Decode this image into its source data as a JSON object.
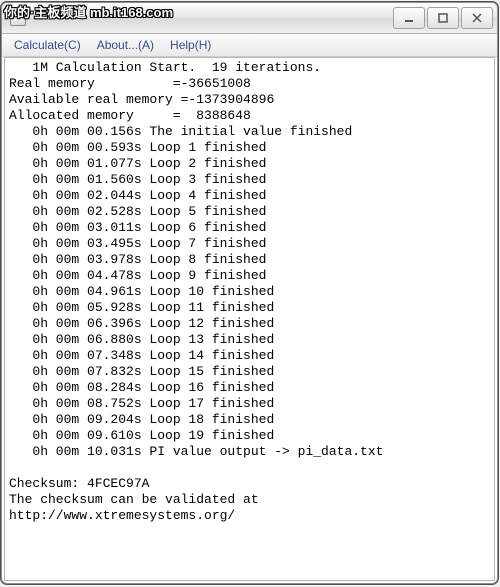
{
  "watermark": "你的·主板频道 mb.it168.com",
  "menubar": {
    "calculate": "Calculate(C)",
    "about": "About...(A)",
    "help": "Help(H)"
  },
  "console": {
    "header": "   1M Calculation Start.  19 iterations.",
    "mem": {
      "real": "Real memory          =-36651008",
      "avail": "Available real memory =-1373904896",
      "alloc": "Allocated memory     =  8388648"
    },
    "initial": "   0h 00m 00.156s The initial value finished",
    "loops": [
      "   0h 00m 00.593s Loop 1 finished",
      "   0h 00m 01.077s Loop 2 finished",
      "   0h 00m 01.560s Loop 3 finished",
      "   0h 00m 02.044s Loop 4 finished",
      "   0h 00m 02.528s Loop 5 finished",
      "   0h 00m 03.011s Loop 6 finished",
      "   0h 00m 03.495s Loop 7 finished",
      "   0h 00m 03.978s Loop 8 finished",
      "   0h 00m 04.478s Loop 9 finished",
      "   0h 00m 04.961s Loop 10 finished",
      "   0h 00m 05.928s Loop 11 finished",
      "   0h 00m 06.396s Loop 12 finished",
      "   0h 00m 06.880s Loop 13 finished",
      "   0h 00m 07.348s Loop 14 finished",
      "   0h 00m 07.832s Loop 15 finished",
      "   0h 00m 08.284s Loop 16 finished",
      "   0h 00m 08.752s Loop 17 finished",
      "   0h 00m 09.204s Loop 18 finished",
      "   0h 00m 09.610s Loop 19 finished"
    ],
    "output": "   0h 00m 10.031s PI value output -> pi_data.txt",
    "blank": "",
    "checksum": "Checksum: 4FCEC97A",
    "validated": "The checksum can be validated at",
    "url": "http://www.xtremesystems.org/"
  }
}
